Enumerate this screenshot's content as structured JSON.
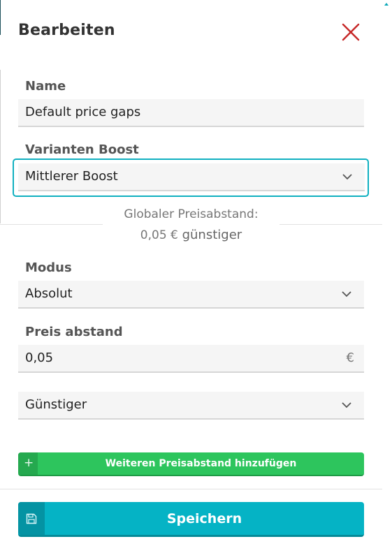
{
  "dialog": {
    "title": "Bearbeiten",
    "close_icon": "close-icon"
  },
  "form": {
    "name": {
      "label": "Name",
      "value": "Default price gaps"
    },
    "variant_boost": {
      "label": "Varianten Boost",
      "selected": "Mittlerer Boost"
    },
    "notice": {
      "line1": "Globaler Preisabstand:",
      "amount": "0,05 €",
      "suffix": " günstiger"
    },
    "mode": {
      "label": "Modus",
      "selected": "Absolut"
    },
    "price_gap": {
      "label": "Preis abstand",
      "value": "0,05",
      "unit": "€"
    },
    "direction": {
      "selected": "Günstiger"
    }
  },
  "buttons": {
    "add_gap": {
      "label": "Weiteren Preisabstand hinzufügen",
      "icon": "plus-icon"
    },
    "save": {
      "label": "Speichern",
      "icon": "save-icon"
    }
  },
  "colors": {
    "accent": "#05b3c5",
    "success": "#2dc55d",
    "close": "#c62828"
  }
}
